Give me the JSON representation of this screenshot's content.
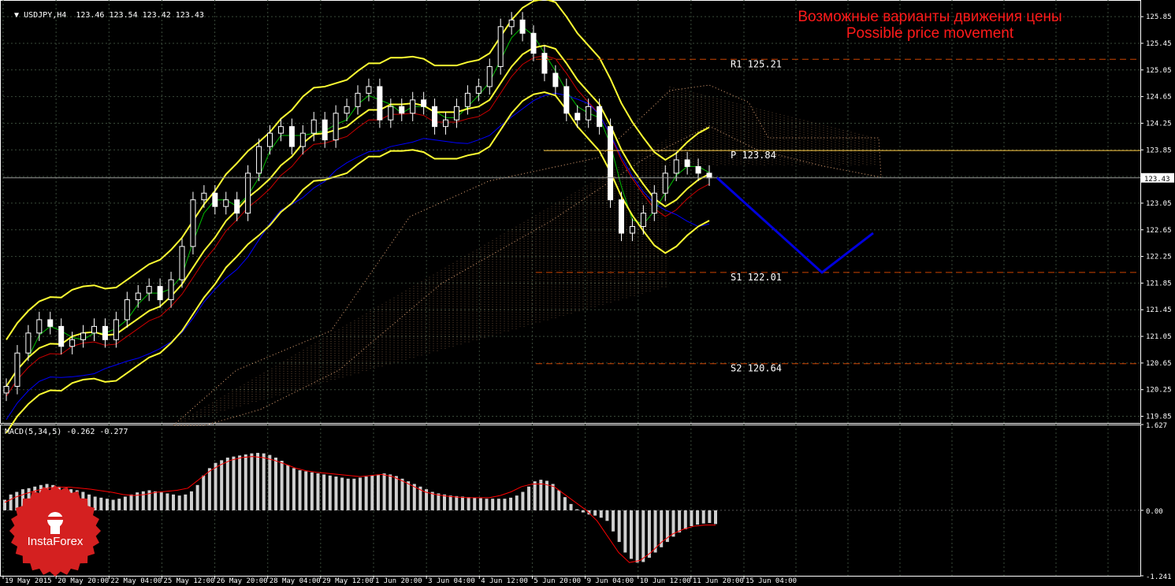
{
  "header": {
    "symbol": "USDJPY,H4",
    "ohlc": "123.46 123.54 123.42 123.43",
    "macd_label": "MACD(5,34,5) -0.262 -0.277"
  },
  "banner": {
    "line_ru": "Возможные варианты движения цены",
    "line_en": "Possible price movement"
  },
  "logo": {
    "text": "InstaForex"
  },
  "colors": {
    "background": "#000000",
    "grid": "#3a4a3a",
    "candle": "#ffffff",
    "bollinger": "#ffff33",
    "red_line": "#cc0000",
    "blue_line": "#0000ff",
    "green_line": "#00c000",
    "cloud": "#e8a878",
    "forecast": "#0000dd",
    "level_line": "#cc4400",
    "pivot_line": "#ffcc44",
    "macd_signal": "#ff0000",
    "macd_bars": "#cfcfcf",
    "banner": "#ff1a1a",
    "logo": "#d42020"
  },
  "chart_data": [
    {
      "type": "candlestick",
      "title": "USDJPY,H4",
      "ylim": [
        119.75,
        126.1
      ],
      "price_ticks": [
        "125.85",
        "125.45",
        "125.05",
        "124.65",
        "124.25",
        "123.85",
        "123.45",
        "123.05",
        "122.65",
        "122.25",
        "121.85",
        "121.45",
        "121.05",
        "120.65",
        "120.25",
        "119.85"
      ],
      "current_price": "123.43",
      "time_labels": [
        "19 May 2015",
        "20 May 20:00",
        "22 May 04:00",
        "25 May 12:00",
        "26 May 20:00",
        "28 May 04:00",
        "29 May 12:00",
        "1 Jun 20:00",
        "3 Jun 04:00",
        "4 Jun 12:00",
        "5 Jun 20:00",
        "9 Jun 04:00",
        "10 Jun 12:00",
        "11 Jun 20:00",
        "15 Jun 04:00"
      ],
      "levels": [
        {
          "name": "R1",
          "label": "R1 125.21",
          "value": 125.21,
          "style": "dashed"
        },
        {
          "name": "P",
          "label": "P 123.84",
          "value": 123.84,
          "style": "solid"
        },
        {
          "name": "S1",
          "label": "S1 122.01",
          "value": 122.01,
          "style": "dashed"
        },
        {
          "name": "S2",
          "label": "S2 120.64",
          "value": 120.64,
          "style": "dashed"
        }
      ],
      "close_path": [
        120.3,
        120.8,
        121.1,
        121.3,
        121.2,
        120.9,
        121.0,
        121.1,
        121.2,
        121.0,
        121.3,
        121.6,
        121.7,
        121.8,
        121.6,
        121.9,
        122.4,
        123.1,
        123.2,
        123.0,
        123.1,
        122.9,
        123.5,
        123.9,
        124.1,
        124.2,
        123.9,
        124.1,
        124.3,
        124.0,
        124.4,
        124.5,
        124.7,
        124.8,
        124.3,
        124.5,
        124.4,
        124.6,
        124.5,
        124.2,
        124.3,
        124.5,
        124.7,
        124.8,
        125.1,
        125.7,
        125.8,
        125.6,
        125.3,
        125.0,
        124.8,
        124.4,
        124.3,
        124.5,
        124.2,
        123.1,
        122.6,
        122.7,
        122.9,
        123.2,
        123.5,
        123.7,
        123.6,
        123.5,
        123.43
      ],
      "forecast_path": [
        {
          "label": "start",
          "value": 123.43
        },
        {
          "label": "low",
          "value": 122.01
        },
        {
          "label": "end",
          "value": 122.6
        }
      ]
    },
    {
      "type": "bar",
      "title": "MACD(5,34,5) -0.262 -0.277",
      "ylim": [
        -1.241,
        1.627
      ],
      "tick_labels": [
        "1.627",
        "0.00",
        "-1.241"
      ],
      "histogram": [
        0.2,
        0.3,
        0.35,
        0.4,
        0.42,
        0.45,
        0.48,
        0.5,
        0.48,
        0.45,
        0.42,
        0.4,
        0.38,
        0.35,
        0.3,
        0.26,
        0.24,
        0.22,
        0.2,
        0.22,
        0.26,
        0.3,
        0.34,
        0.36,
        0.38,
        0.36,
        0.34,
        0.32,
        0.3,
        0.28,
        0.3,
        0.36,
        0.48,
        0.66,
        0.8,
        0.9,
        0.95,
        1.0,
        1.02,
        1.04,
        1.06,
        1.08,
        1.09,
        1.08,
        1.05,
        1.0,
        0.94,
        0.86,
        0.8,
        0.76,
        0.74,
        0.72,
        0.7,
        0.68,
        0.66,
        0.64,
        0.62,
        0.6,
        0.6,
        0.62,
        0.64,
        0.66,
        0.68,
        0.7,
        0.68,
        0.65,
        0.6,
        0.55,
        0.5,
        0.45,
        0.4,
        0.35,
        0.32,
        0.3,
        0.28,
        0.27,
        0.26,
        0.25,
        0.24,
        0.23,
        0.22,
        0.22,
        0.22,
        0.22,
        0.24,
        0.28,
        0.35,
        0.45,
        0.55,
        0.58,
        0.56,
        0.5,
        0.38,
        0.25,
        0.12,
        0.02,
        -0.04,
        -0.08,
        -0.1,
        -0.14,
        -0.2,
        -0.4,
        -0.6,
        -0.8,
        -0.92,
        -0.99,
        -0.98,
        -0.9,
        -0.8,
        -0.7,
        -0.6,
        -0.5,
        -0.42,
        -0.36,
        -0.3,
        -0.27,
        -0.25,
        -0.24,
        -0.26
      ],
      "signal": [
        0.15,
        0.25,
        0.32,
        0.38,
        0.42,
        0.44,
        0.44,
        0.42,
        0.4,
        0.37,
        0.34,
        0.3,
        0.28,
        0.3,
        0.34,
        0.36,
        0.38,
        0.42,
        0.58,
        0.74,
        0.86,
        0.95,
        1.0,
        1.02,
        1.0,
        0.95,
        0.88,
        0.8,
        0.75,
        0.72,
        0.7,
        0.68,
        0.66,
        0.64,
        0.66,
        0.68,
        0.64,
        0.55,
        0.45,
        0.35,
        0.3,
        0.27,
        0.25,
        0.24,
        0.24,
        0.24,
        0.28,
        0.35,
        0.45,
        0.5,
        0.5,
        0.45,
        0.3,
        0.15,
        0.0,
        -0.2,
        -0.5,
        -0.8,
        -0.99,
        -0.95,
        -0.8,
        -0.6,
        -0.45,
        -0.36,
        -0.3,
        -0.28,
        -0.28
      ]
    }
  ]
}
